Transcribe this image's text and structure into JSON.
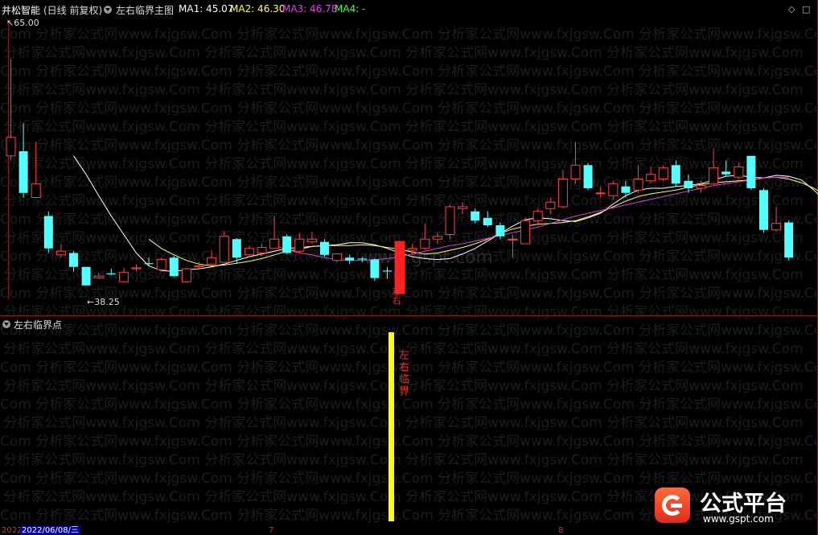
{
  "header": {
    "stock_name": "井松智能",
    "period": "(日线 前复权)",
    "indicator_name": "左右临界主图",
    "ma1_label": "MA1: 45.07",
    "ma2_label": "MA2: 46.30",
    "ma3_label": "MA3: 46.78",
    "ma4_label": "MA4: -",
    "ma1_color": "#ffffff",
    "ma2_color": "#ffff66",
    "ma3_color": "#e040e0",
    "ma4_color": "#40ff40",
    "controls": [
      "◇",
      "□"
    ]
  },
  "price_axis": {
    "high_label": "65.00",
    "low_label": "38.25"
  },
  "sub_panel": {
    "title": "左右临界点",
    "bar_text": "左右临界"
  },
  "signal": {
    "candle_text": "左右"
  },
  "watermark": {
    "text": "Com 分析家公式网www.fxjgsw.Com 分析家公式网www.fxjgsw.Com 分析家公式网www.fxjgsw.Com 分析家公式网www.fxjgsw.Com",
    "center": "www.gspt.com"
  },
  "bottom": {
    "date_prefix": "2022",
    "date": "2022/06/08/三",
    "tick_7": "7",
    "tick_8": "8"
  },
  "brand": {
    "name": "公式平台",
    "url": "www.gspt.com"
  },
  "chart_data": {
    "type": "candlestick",
    "candles": [
      {
        "o": 51.5,
        "c": 53.5,
        "h": 62.0,
        "l": 51.0
      },
      {
        "o": 52.0,
        "c": 47.5,
        "h": 55.0,
        "l": 47.0
      },
      {
        "o": 47.0,
        "c": 48.5,
        "h": 53.0,
        "l": 47.0
      },
      {
        "o": 45.0,
        "c": 41.5,
        "h": 45.5,
        "l": 41.0
      },
      {
        "o": 40.8,
        "c": 41.2,
        "h": 42.0,
        "l": 40.5
      },
      {
        "o": 41.0,
        "c": 39.5,
        "h": 41.2,
        "l": 39.0
      },
      {
        "o": 39.5,
        "c": 37.5,
        "h": 39.5,
        "l": 37.5
      },
      {
        "o": 38.3,
        "c": 38.5,
        "h": 38.8,
        "l": 38.2
      },
      {
        "o": 38.8,
        "c": 38.7,
        "h": 39.3,
        "l": 38.6
      },
      {
        "o": 37.9,
        "c": 38.9,
        "h": 39.4,
        "l": 37.8
      },
      {
        "o": 39.3,
        "c": 39.4,
        "h": 39.8,
        "l": 39.0
      },
      {
        "o": 39.9,
        "c": 39.8,
        "h": 40.5,
        "l": 39.6
      },
      {
        "o": 39.2,
        "c": 40.3,
        "h": 40.5,
        "l": 39.0
      },
      {
        "o": 40.5,
        "c": 38.5,
        "h": 40.7,
        "l": 38.4
      },
      {
        "o": 37.9,
        "c": 39.3,
        "h": 39.4,
        "l": 37.8
      },
      {
        "o": 39.5,
        "c": 39.6,
        "h": 40.0,
        "l": 39.3
      },
      {
        "o": 39.8,
        "c": 40.5,
        "h": 41.3,
        "l": 39.7
      },
      {
        "o": 40.0,
        "c": 42.8,
        "h": 43.4,
        "l": 40.0
      },
      {
        "o": 42.5,
        "c": 40.5,
        "h": 42.6,
        "l": 39.9
      },
      {
        "o": 40.8,
        "c": 41.5,
        "h": 41.8,
        "l": 40.5
      },
      {
        "o": 41.0,
        "c": 41.6,
        "h": 42.0,
        "l": 40.7
      },
      {
        "o": 41.5,
        "c": 42.5,
        "h": 45.0,
        "l": 41.5
      },
      {
        "o": 42.8,
        "c": 41.0,
        "h": 43.0,
        "l": 40.9
      },
      {
        "o": 41.2,
        "c": 42.5,
        "h": 43.2,
        "l": 41.0
      },
      {
        "o": 42.2,
        "c": 42.5,
        "h": 43.3,
        "l": 42.0
      },
      {
        "o": 42.2,
        "c": 40.8,
        "h": 42.5,
        "l": 40.6
      },
      {
        "o": 40.2,
        "c": 40.9,
        "h": 41.0,
        "l": 40.0
      },
      {
        "o": 40.5,
        "c": 40.2,
        "h": 40.8,
        "l": 39.8
      },
      {
        "o": 40.4,
        "c": 40.3,
        "h": 40.6,
        "l": 40.0
      },
      {
        "o": 40.3,
        "c": 38.3,
        "h": 40.4,
        "l": 38.0
      },
      {
        "o": 39.1,
        "c": 39.0,
        "h": 39.5,
        "l": 38.2
      },
      {
        "o": 38.5,
        "c": 42.0,
        "h": 42.2,
        "l": 38.5
      },
      {
        "o": 41.3,
        "c": 41.5,
        "h": 42.0,
        "l": 40.8
      },
      {
        "o": 41.5,
        "c": 42.5,
        "h": 44.2,
        "l": 41.3
      },
      {
        "o": 42.5,
        "c": 42.8,
        "h": 43.2,
        "l": 42.0
      },
      {
        "o": 43.0,
        "c": 46.0,
        "h": 46.2,
        "l": 42.5
      },
      {
        "o": 45.8,
        "c": 46.0,
        "h": 46.5,
        "l": 45.2
      },
      {
        "o": 45.5,
        "c": 44.5,
        "h": 45.8,
        "l": 44.2
      },
      {
        "o": 44.8,
        "c": 44.0,
        "h": 45.5,
        "l": 43.8
      },
      {
        "o": 44.0,
        "c": 42.8,
        "h": 44.3,
        "l": 42.5
      },
      {
        "o": 42.5,
        "c": 42.5,
        "h": 43.0,
        "l": 40.5
      },
      {
        "o": 42.0,
        "c": 44.5,
        "h": 44.8,
        "l": 42.0
      },
      {
        "o": 44.5,
        "c": 45.5,
        "h": 45.8,
        "l": 44.0
      },
      {
        "o": 45.8,
        "c": 46.5,
        "h": 47.0,
        "l": 45.2
      },
      {
        "o": 46.0,
        "c": 49.0,
        "h": 50.0,
        "l": 45.8
      },
      {
        "o": 49.0,
        "c": 50.5,
        "h": 53.0,
        "l": 48.5
      },
      {
        "o": 50.5,
        "c": 48.0,
        "h": 50.7,
        "l": 47.8
      },
      {
        "o": 47.5,
        "c": 47.5,
        "h": 48.2,
        "l": 47.0
      },
      {
        "o": 47.2,
        "c": 48.5,
        "h": 48.8,
        "l": 46.8
      },
      {
        "o": 48.2,
        "c": 47.5,
        "h": 48.8,
        "l": 47.0
      },
      {
        "o": 47.8,
        "c": 49.0,
        "h": 50.5,
        "l": 47.5
      },
      {
        "o": 48.8,
        "c": 49.5,
        "h": 50.3,
        "l": 48.5
      },
      {
        "o": 49.0,
        "c": 50.2,
        "h": 50.5,
        "l": 48.8
      },
      {
        "o": 50.5,
        "c": 48.5,
        "h": 51.0,
        "l": 48.2
      },
      {
        "o": 48.8,
        "c": 48.0,
        "h": 49.5,
        "l": 47.5
      },
      {
        "o": 48.0,
        "c": 48.3,
        "h": 48.8,
        "l": 47.5
      },
      {
        "o": 48.5,
        "c": 50.2,
        "h": 52.3,
        "l": 48.5
      },
      {
        "o": 49.8,
        "c": 49.5,
        "h": 51.0,
        "l": 49.3
      },
      {
        "o": 49.2,
        "c": 50.3,
        "h": 50.8,
        "l": 49.0
      },
      {
        "o": 51.5,
        "c": 48.0,
        "h": 51.5,
        "l": 47.8
      },
      {
        "o": 47.8,
        "c": 43.5,
        "h": 48.0,
        "l": 43.2
      },
      {
        "o": 43.5,
        "c": 44.2,
        "h": 46.0,
        "l": 43.3
      },
      {
        "o": 44.3,
        "c": 40.5,
        "h": 44.5,
        "l": 40.2
      }
    ],
    "signal_index": 31,
    "ma_lines": [
      {
        "name": "MA1",
        "color": "#ffffff",
        "start": 5,
        "values": [
          51.5,
          49.5,
          47.2,
          45.0,
          43.0,
          41.0,
          39.6,
          39.1,
          39.0,
          39.2,
          39.3,
          39.5,
          39.8,
          40.2,
          40.6,
          40.9,
          41.2,
          41.5,
          41.6,
          41.7,
          41.8,
          41.9,
          42.1,
          42.1,
          41.9,
          41.5,
          41.0,
          40.6,
          40.4,
          40.3,
          40.4,
          40.9,
          41.5,
          42.3,
          43.1,
          43.9,
          44.6,
          44.8,
          44.7,
          44.5,
          44.4,
          44.8,
          45.3,
          46.3,
          47.2,
          47.8,
          48.0,
          48.0,
          48.2,
          48.3,
          48.5,
          48.9,
          49.3,
          49.4,
          49.2,
          49.1,
          49.4,
          49.3,
          48.9,
          47.8,
          46.5,
          45.2
        ]
      },
      {
        "name": "MA2",
        "color": "#ffff66",
        "start": 11,
        "values": [
          42.5,
          41.5,
          40.8,
          40.2,
          39.8,
          39.6,
          39.7,
          39.9,
          40.1,
          40.4,
          40.8,
          41.2,
          41.4,
          41.7,
          41.8,
          41.8,
          41.8,
          41.9,
          41.8,
          41.6,
          41.4,
          41.1,
          40.9,
          41.0,
          41.3,
          41.6,
          42.0,
          42.5,
          43.1,
          43.6,
          43.9,
          44.1,
          44.2,
          44.3,
          44.5,
          44.9,
          45.4,
          46.0,
          46.6,
          47.1,
          47.4,
          47.6,
          47.8,
          48.1,
          48.4,
          48.6,
          48.7,
          48.8,
          48.9,
          49.1,
          49.2,
          49.0,
          48.6,
          48.0,
          47.2
        ]
      },
      {
        "name": "MA3",
        "color": "#d040d0",
        "start": 21,
        "values": [
          41.8,
          41.4,
          41.0,
          40.8,
          40.5,
          40.3,
          40.2,
          40.2,
          40.3,
          40.4,
          40.6,
          40.9,
          41.2,
          41.5,
          41.8,
          42.0,
          42.3,
          42.6,
          42.9,
          43.2,
          43.5,
          43.8,
          44.2,
          44.6,
          45.0,
          45.3,
          45.6,
          45.9,
          46.2,
          46.5,
          46.8,
          47.1,
          47.4,
          47.7,
          48.0,
          48.3,
          48.5,
          48.7,
          48.9,
          49.1,
          49.2,
          49.2
        ]
      }
    ],
    "ylim": [
      36,
      66
    ]
  }
}
